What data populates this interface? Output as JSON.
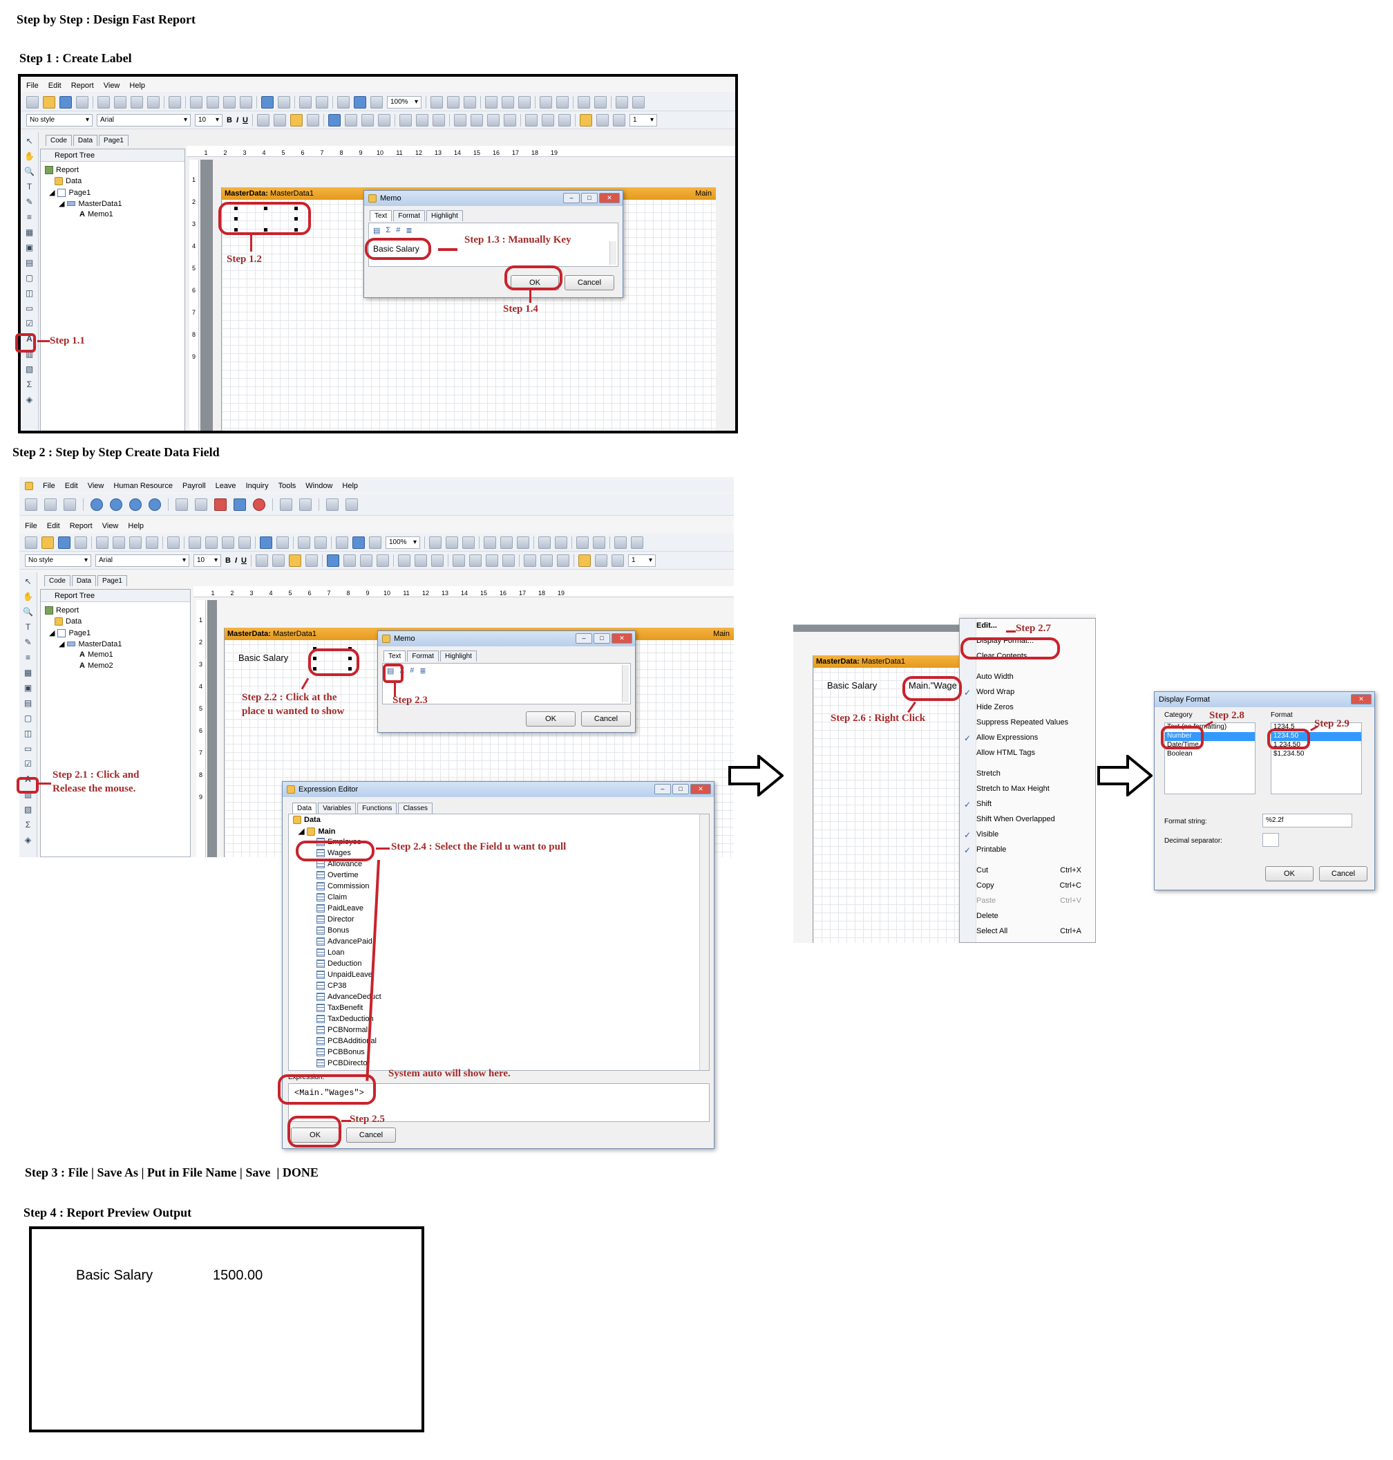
{
  "page": {
    "title": "Step by Step : Design Fast Report",
    "step1_heading": "Step 1 : Create Label",
    "step2_heading": "Step 2 : Step by Step Create Data Field",
    "step3_heading": "Step 3 : File | Save As | Put in File Name | Save",
    "step3_done": "| DONE",
    "step4_heading": "Step 4 : Report Preview Output"
  },
  "designer": {
    "menu": [
      "File",
      "Edit",
      "Report",
      "View",
      "Help"
    ],
    "style_combo": "No style",
    "font_combo": "Arial",
    "size_combo": "10",
    "zoom_combo": "100%",
    "line_combo": "1",
    "tabs_step1": [
      "Code",
      "Data",
      "Page1"
    ],
    "tabs_step2": [
      "Code",
      "Data",
      "Page1"
    ],
    "report_tree_label": "Report Tree",
    "tree_step1": [
      "Report",
      "Data",
      "Page1",
      "MasterData1",
      "Memo1"
    ],
    "tree_step2": [
      "Report",
      "Data",
      "Page1",
      "MasterData1",
      "Memo1",
      "Memo2"
    ],
    "ruler": [
      "1",
      "2",
      "3",
      "4",
      "5",
      "6",
      "7",
      "8",
      "9",
      "10",
      "11",
      "12",
      "13",
      "14",
      "15",
      "16",
      "17",
      "18",
      "19"
    ],
    "vruler": [
      "1",
      "2",
      "3",
      "4",
      "5",
      "6",
      "7",
      "8",
      "9"
    ],
    "band_label": "MasterData:",
    "band_name": "MasterData1",
    "band_right": "Main",
    "bold_labels": [
      "B",
      "I",
      "U"
    ]
  },
  "app_step2": {
    "menu": [
      "File",
      "Edit",
      "View",
      "Human Resource",
      "Payroll",
      "Leave",
      "Inquiry",
      "Tools",
      "Window",
      "Help"
    ]
  },
  "memo_dialog": {
    "title": "Memo",
    "tabs": [
      "Text",
      "Format",
      "Highlight"
    ],
    "text_value": "Basic Salary",
    "ok": "OK",
    "cancel": "Cancel"
  },
  "memo_dialog2": {
    "title": "Memo",
    "tabs": [
      "Text",
      "Format",
      "Highlight"
    ],
    "ok": "OK",
    "cancel": "Cancel"
  },
  "canvas_step2": {
    "label_text": "Basic Salary"
  },
  "expression_editor": {
    "title": "Expression Editor",
    "tabs": [
      "Data",
      "Variables",
      "Functions",
      "Classes"
    ],
    "root": "Data",
    "db": "Main",
    "fields": [
      "Employee",
      "Wages",
      "Allowance",
      "Overtime",
      "Commission",
      "Claim",
      "PaidLeave",
      "Director",
      "Bonus",
      "AdvancePaid",
      "Loan",
      "Deduction",
      "UnpaidLeave",
      "CP38",
      "AdvanceDeduct",
      "TaxBenefit",
      "TaxDeduction",
      "PCBNormal",
      "PCBAdditional",
      "PCBBonus",
      "PCBDirector"
    ],
    "expression_label": "Expression:",
    "expression_value": "<Main.\"Wages\">",
    "ok": "OK",
    "cancel": "Cancel"
  },
  "context_panel": {
    "band_label": "MasterData:",
    "band_name": "MasterData1",
    "label_text": "Basic Salary",
    "memo_text": "Main.\"Wage",
    "items": [
      {
        "label": "Edit...",
        "check": false,
        "shortcut": "",
        "bold": true
      },
      {
        "label": "Display Format...",
        "check": false,
        "shortcut": ""
      },
      {
        "label": "Clear Contents",
        "check": false,
        "shortcut": ""
      },
      {
        "label": "Auto Width",
        "check": false,
        "shortcut": ""
      },
      {
        "label": "Word Wrap",
        "check": true,
        "shortcut": ""
      },
      {
        "label": "Hide Zeros",
        "check": false,
        "shortcut": ""
      },
      {
        "label": "Suppress Repeated Values",
        "check": false,
        "shortcut": ""
      },
      {
        "label": "Allow Expressions",
        "check": true,
        "shortcut": ""
      },
      {
        "label": "Allow HTML Tags",
        "check": false,
        "shortcut": ""
      },
      {
        "label": "Stretch",
        "check": false,
        "shortcut": ""
      },
      {
        "label": "Stretch to Max Height",
        "check": false,
        "shortcut": ""
      },
      {
        "label": "Shift",
        "check": true,
        "shortcut": ""
      },
      {
        "label": "Shift When Overlapped",
        "check": false,
        "shortcut": ""
      },
      {
        "label": "Visible",
        "check": true,
        "shortcut": ""
      },
      {
        "label": "Printable",
        "check": true,
        "shortcut": ""
      },
      {
        "label": "Cut",
        "check": false,
        "shortcut": "Ctrl+X"
      },
      {
        "label": "Copy",
        "check": false,
        "shortcut": "Ctrl+C"
      },
      {
        "label": "Paste",
        "check": false,
        "shortcut": "Ctrl+V",
        "disabled": true
      },
      {
        "label": "Delete",
        "check": false,
        "shortcut": ""
      },
      {
        "label": "Select All",
        "check": false,
        "shortcut": "Ctrl+A"
      }
    ]
  },
  "display_format": {
    "title": "Display Format",
    "category_label": "Category",
    "format_label": "Format",
    "categories": [
      "Text (no formatting)",
      "Number",
      "Date/Time",
      "Boolean"
    ],
    "formats": [
      "1234.5",
      "1234.50",
      "1,234.50",
      "$1,234.50"
    ],
    "format_string_label": "Format string:",
    "format_string_value": "%2.2f",
    "decimal_sep_label": "Decimal separator:",
    "ok": "OK",
    "cancel": "Cancel"
  },
  "annotations": {
    "s11": "Step 1.1",
    "s12": "Step 1.2",
    "s13": "Step 1.3 : Manually Key",
    "s14": "Step 1.4",
    "s21": "Step 2.1 : Click and\nRelease the mouse.",
    "s21a": "Step 2.1 : Click and",
    "s21b": "Release the mouse.",
    "s22a": "Step 2.2 : Click at the",
    "s22b": "place u wanted to show",
    "s23": "Step 2.3",
    "s24": "Step 2.4 : Select the Field u want to pull",
    "s25": "Step 2.5",
    "auto": "System auto will show here.",
    "s26": "Step 2.6 : Right Click",
    "s27": "Step 2.7",
    "s28": "Step 2.8",
    "s29": "Step 2.9"
  },
  "preview": {
    "label": "Basic Salary",
    "value": "1500.00"
  },
  "colors": {
    "annotation_red": "#c8232c",
    "annotation_text": "#a52a2a",
    "band_orange": "#f5b341",
    "selection_blue": "#3399ff"
  }
}
